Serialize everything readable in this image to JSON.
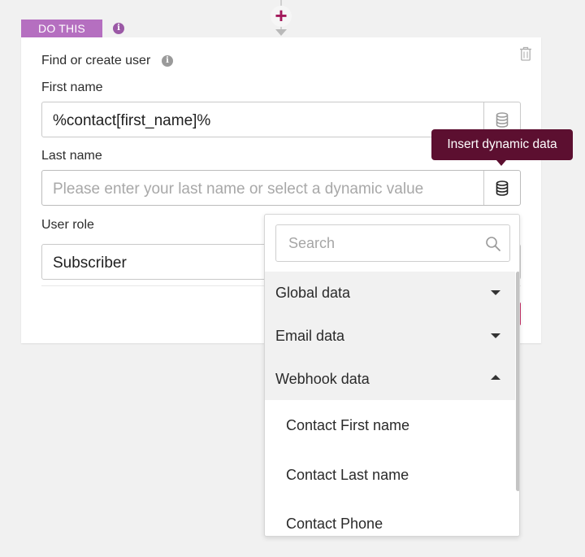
{
  "flow": {
    "add_step_symbol": "+",
    "tab_label": "DO THIS"
  },
  "card": {
    "title": "Find or create user",
    "fields": [
      {
        "label": "First name",
        "value": "%contact[first_name]%",
        "placeholder": ""
      },
      {
        "label": "Last name",
        "value": "",
        "placeholder": "Please enter your last name or select a dynamic value"
      },
      {
        "label": "User role",
        "value": "Subscriber",
        "placeholder": ""
      }
    ]
  },
  "tooltip": {
    "text": "Insert dynamic data"
  },
  "dropdown": {
    "search_placeholder": "Search",
    "groups": [
      {
        "label": "Global data",
        "expanded": false
      },
      {
        "label": "Email data",
        "expanded": false
      },
      {
        "label": "Webhook data",
        "expanded": true
      }
    ],
    "items": [
      "Contact First name",
      "Contact Last name",
      "Contact Phone"
    ]
  },
  "colors": {
    "tab": "#b56fc0",
    "tooltip": "#5c0f30",
    "add_step": "#a3195b",
    "group_bg": "#f1f1f1"
  },
  "icons": [
    "plus-icon",
    "info-icon",
    "trash-icon",
    "database-icon",
    "search-icon",
    "caret-down-icon",
    "caret-up-icon"
  ]
}
